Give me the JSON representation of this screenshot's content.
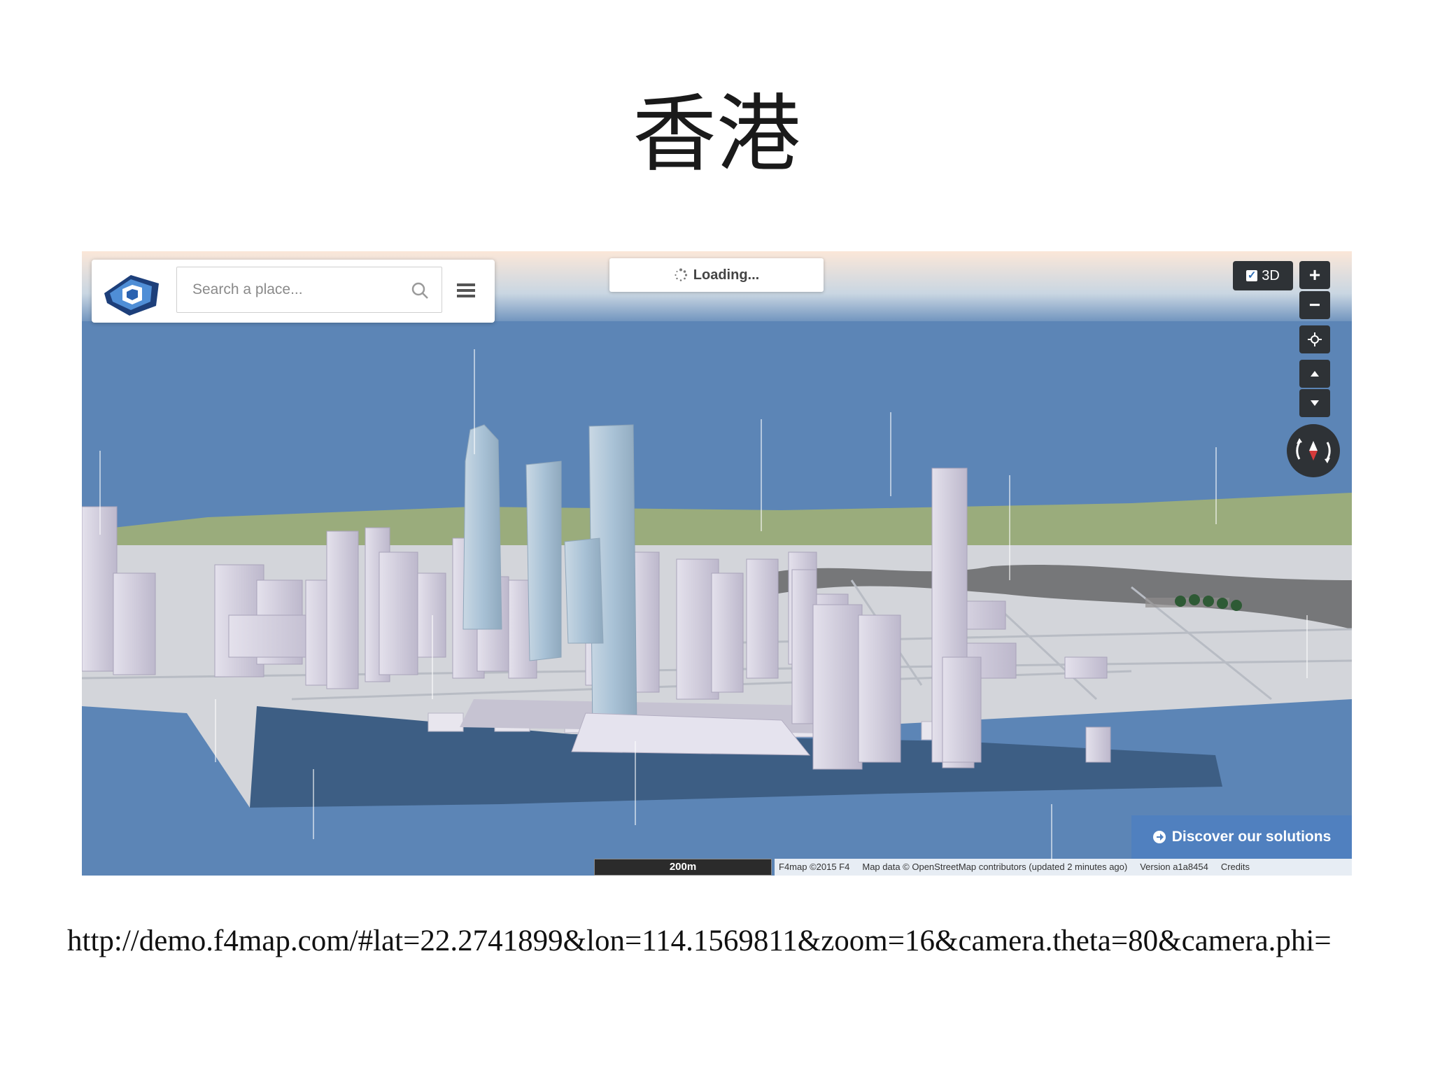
{
  "slide": {
    "title": "香港",
    "url": "http://demo.f4map.com/#lat=22.2741899&lon=114.1569811&zoom=16&camera.theta=80&camera.phi="
  },
  "map": {
    "search": {
      "placeholder": "Search a place...",
      "value": ""
    },
    "loading_label": "Loading...",
    "toggle_3d": {
      "label": "3D",
      "checked": true
    },
    "controls": {
      "zoom_in": "+",
      "zoom_out": "−"
    },
    "discover_label": "Discover our solutions",
    "scale_label": "200m",
    "attribution": {
      "copyright": "F4map ©2015 F4",
      "map_data": "Map data © OpenStreetMap contributors (updated 2 minutes ago)",
      "version": "Version a1a8454",
      "credits": "Credits"
    },
    "icons": [
      "f4map-logo-icon",
      "search-icon",
      "menu-icon",
      "spinner-icon",
      "checkbox-icon",
      "plus-icon",
      "minus-icon",
      "locate-icon",
      "tilt-up-icon",
      "tilt-down-icon",
      "compass-icon",
      "arrow-circle-icon"
    ],
    "colors": {
      "sea": "#5c85b6",
      "land": "#cfd3d8",
      "buildings": "#d8d4e3",
      "control": "#2e3236",
      "discover": "#4f80c0"
    }
  }
}
